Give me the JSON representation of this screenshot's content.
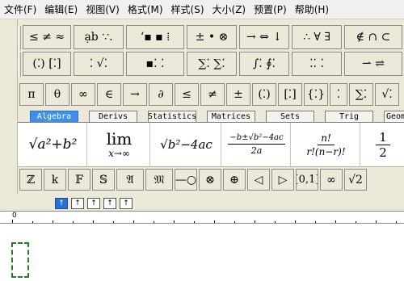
{
  "menu": [
    "文件(F)",
    "编辑(E)",
    "视图(V)",
    "格式(M)",
    "样式(S)",
    "大小(Z)",
    "预置(P)",
    "帮助(H)"
  ],
  "palette_row1": [
    "≤ ≠ ≈",
    "ạb ∵.",
    "ʻ▪ ▪ ⁞",
    "± • ⊗",
    "→ ⇔ ↓",
    "∴ ∀ ∃",
    "∉ ∩ ⊂"
  ],
  "palette_row2": [
    "(⁚) [⁚]",
    "⁚ √⁚",
    "▪⁚ ⁚",
    "∑⁚ ∑⁚",
    "∫⁚ ∮⁚",
    "⁚⁚ ⁚",
    "⇀ ⇌"
  ],
  "symbol_row": [
    "π",
    "θ",
    "∞",
    "∈",
    "→",
    "∂",
    "≤",
    "≠",
    "±",
    "(⁚)",
    "[⁚]",
    "{⁚}",
    "⁚",
    "∑⁚",
    "√⁚"
  ],
  "tabs": [
    "Algebra",
    "Derivs",
    "Statistics",
    "Matrices",
    "Sets",
    "Trig",
    "Geom"
  ],
  "templates": {
    "sqrt_sum": "√a²+b²",
    "lim_word": "lim",
    "lim_sub": "x→∞",
    "sqrt_disc": "√b²−4ac",
    "quad_num": "−b±√b²−4ac",
    "quad_den": "2a",
    "perm_num": "n!",
    "perm_den": "r!(n−r)!",
    "half_num": "1",
    "half_den": "2"
  },
  "fonts_row": [
    "ℤ",
    "k",
    "𝔽",
    "𝕊",
    "𝔄",
    "𝔐",
    "—○",
    "⊗",
    "⊕",
    "◁",
    "▷",
    "[0,1]",
    "∞",
    "√2"
  ],
  "nudge_buttons": [
    "↑",
    "↑",
    "↑",
    "↑",
    "↑"
  ],
  "ruler_zero": "0"
}
